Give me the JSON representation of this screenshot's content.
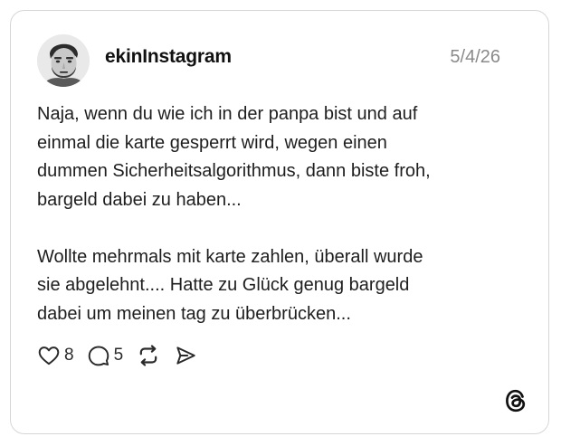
{
  "post": {
    "username": "ekinInstagram",
    "date": "5/4/26",
    "paragraphs": [
      "Naja, wenn du wie ich in der panpa bist und auf\neinmal die karte gesperrt wird, wegen einen\ndummen Sicherheitsalgorithmus, dann biste froh,\nbargeld dabei zu haben...",
      "Wollte mehrmals mit karte zahlen, überall wurde\nsie abgelehnt.... Hatte zu Glück genug bargeld\ndabei um meinen tag zu überbrücken..."
    ],
    "likes": "8",
    "replies": "5"
  },
  "icons": {
    "like": "heart-icon",
    "reply": "comment-bubble-icon",
    "repost": "repost-icon",
    "share": "send-icon",
    "brand": "threads-logo-icon"
  }
}
